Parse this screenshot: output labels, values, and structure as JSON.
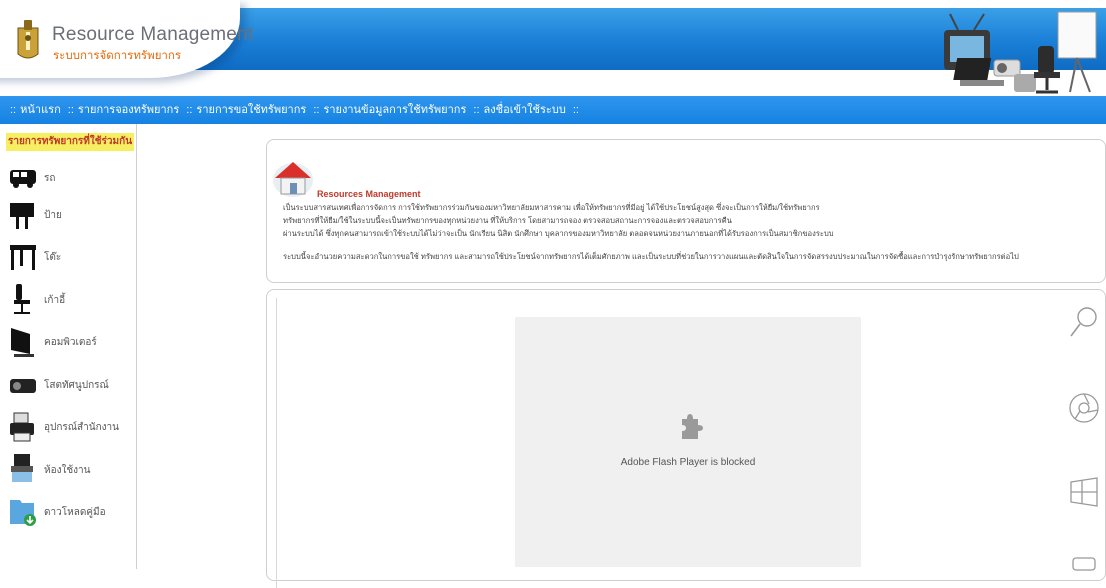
{
  "header": {
    "title_en": "Resource Management",
    "title_th": "ระบบการจัดการทรัพยากร"
  },
  "nav": {
    "items": [
      {
        "label": "หน้าแรก"
      },
      {
        "label": "รายการจองทรัพยากร"
      },
      {
        "label": "รายการขอใช้ทรัพยากร"
      },
      {
        "label": "รายงานข้อมูลการใช้ทรัพยากร"
      },
      {
        "label": "ลงชื่อเข้าใช้ระบบ"
      }
    ],
    "separator": "::"
  },
  "sidebar": {
    "heading": "รายการทรัพยากรที่ใช้ร่วมกัน",
    "items": [
      {
        "label": "รถ",
        "icon": "van-icon"
      },
      {
        "label": "ป้าย",
        "icon": "signboard-icon"
      },
      {
        "label": "โต๊ะ",
        "icon": "table-icon"
      },
      {
        "label": "เก้าอี้",
        "icon": "chair-icon"
      },
      {
        "label": "คอมพิวเตอร์",
        "icon": "computer-icon"
      },
      {
        "label": "โสตทัศนูปกรณ์",
        "icon": "projector-icon"
      },
      {
        "label": "อุปกรณ์สำนักงาน",
        "icon": "printer-icon"
      },
      {
        "label": "ห้องใช้งาน",
        "icon": "room-icon"
      },
      {
        "label": "ดาวโหลดคู่มือ",
        "icon": "download-folder-icon"
      }
    ]
  },
  "info": {
    "title": "Resources Management",
    "lines": [
      "เป็นระบบสารสนเทศเพื่อการจัดการ การใช้ทรัพยากรร่วมกันของมหาวิทยาลัยมหาสารคาม เพื่อให้ทรัพยากรที่มีอยู่ ได้ใช้ประโยชน์สูงสุด ซึ่งจะเป็นการให้ยืม/ใช้ทรัพยากร",
      "ทรัพยากรที่ให้ยืม/ใช้ในระบบนี้จะเป็นทรัพยากรของทุกหน่วยงาน ที่ให้บริการ โดยสามารถจอง ตรวจสอบสถานะการจองและตรวจสอบการคืน",
      "ผ่านระบบได้ ซึ่งทุกคนสามารถเข้าใช้ระบบได้ไม่ว่าจะเป็น นักเรียน นิสิต นักศึกษา บุคลากรของมหาวิทยาลัย ตลอดจนหน่วยงานภายนอกที่ได้รับรองการเป็นสมาชิกของระบบ",
      "ระบบนี้จะอำนวยความสะดวกในการขอใช้ ทรัพยากร และสามารถใช้ประโยชน์จากทรัพยากรได้เต็มศักยภาพ และเป็นระบบที่ช่วยในการวางแผนและตัดสินใจในการจัดสรรงบประมาณในการจัดซื้อและการบำรุงรักษาทรัพยากรต่อไป"
    ]
  },
  "flash": {
    "message": "Adobe Flash Player is blocked"
  },
  "colors": {
    "header_blue": "#1a7fd6",
    "nav_blue": "#1582e2",
    "sidebar_heading_bg": "#f6ef62",
    "sidebar_heading_text": "#c0392b",
    "subtitle_orange": "#e56b0a"
  }
}
